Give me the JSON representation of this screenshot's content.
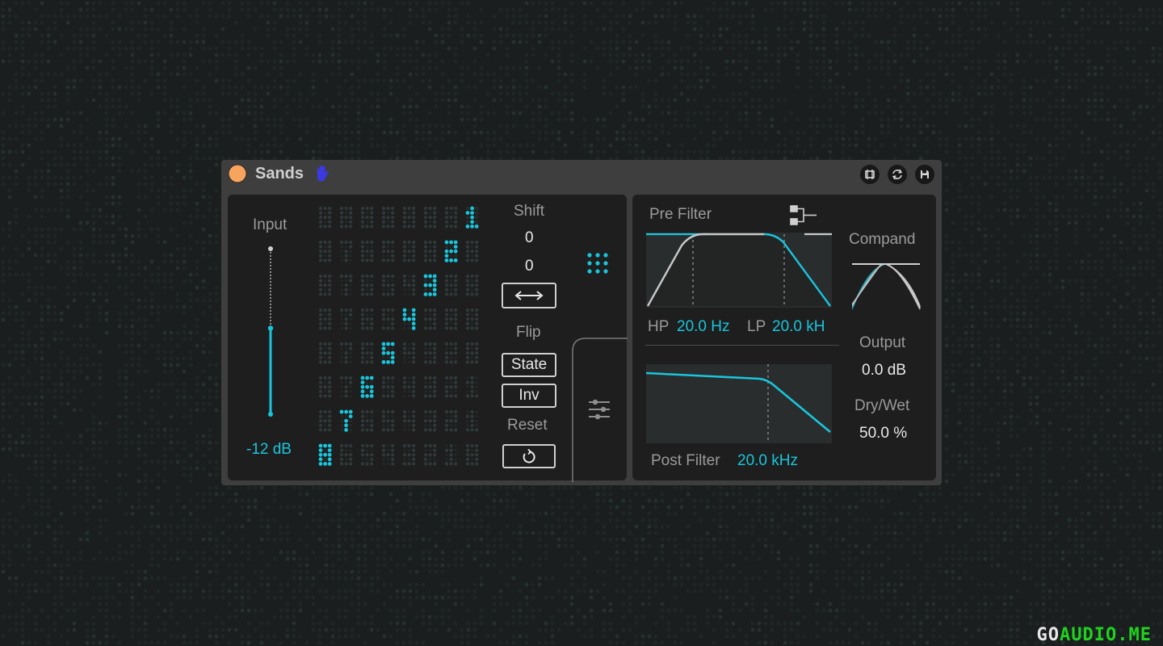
{
  "device": {
    "title": "Sands",
    "colors": {
      "accent": "#19c5dc",
      "power": "#f7a55e",
      "hand": "#3a3ae0"
    },
    "icons": [
      "hand-icon",
      "freeze-icon",
      "hot-swap-icon",
      "save-preset-icon"
    ]
  },
  "input": {
    "label": "Input",
    "value": "-12 dB",
    "level": 0.52
  },
  "bands": {
    "active_digits": [
      "1",
      "2",
      "3",
      "4",
      "5",
      "6",
      "7",
      "8"
    ],
    "ghost_rows": [
      "",
      "8765",
      "87654",
      "876543",
      "8765432",
      "87654321",
      "87654321",
      "7654321"
    ]
  },
  "shift": {
    "label": "Shift",
    "value1": "0",
    "value2": "0",
    "swap_icon": "swap-arrows-icon"
  },
  "flip": {
    "label": "Flip",
    "state_label": "State",
    "inv_label": "Inv"
  },
  "reset": {
    "label": "Reset",
    "reset_icon": "reset-arrow-icon"
  },
  "side_icons": [
    "grid-dots-icon",
    "sliders-icon"
  ],
  "pre_filter": {
    "label": "Pre Filter",
    "routing_icon": "routing-icon",
    "hp_label": "HP",
    "hp_value": "20.0 Hz",
    "lp_label": "LP",
    "lp_value": "20.0 kH"
  },
  "post_filter": {
    "label": "Post Filter",
    "value": "20.0 kHz"
  },
  "compand": {
    "label": "Compand",
    "icon": "compand-curve-icon"
  },
  "output": {
    "label": "Output",
    "value": "0.0 dB"
  },
  "drywet": {
    "label": "Dry/Wet",
    "value": "50.0 %"
  },
  "watermark": {
    "part1": "GO",
    "part2": "AUDIO.ME"
  }
}
